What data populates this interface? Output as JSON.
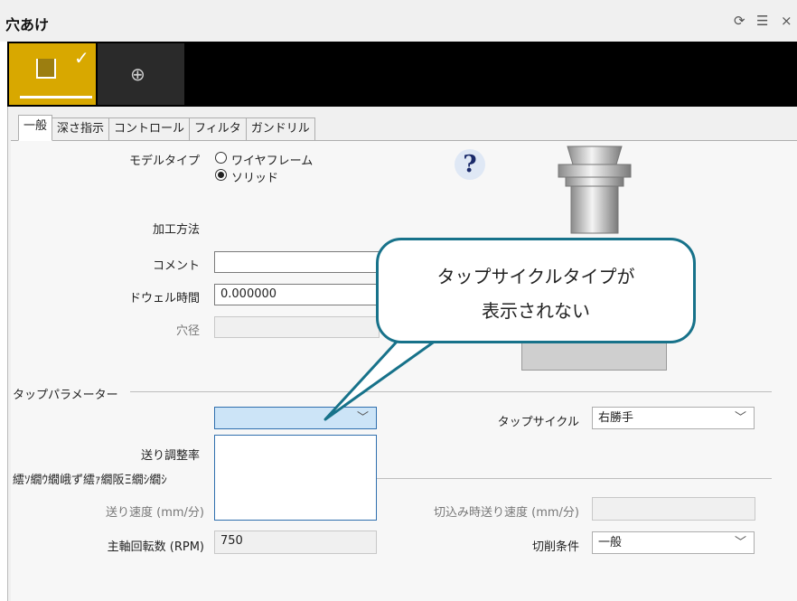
{
  "window": {
    "title": "穴あけ",
    "icons": {
      "pin": "pin-icon",
      "menu": "menu-icon",
      "close": "close-icon"
    }
  },
  "toolbar": {
    "tool_drill": {
      "icon": "drill-tool-icon",
      "checked_icon": "check-icon"
    },
    "tool_position": {
      "icon": "crosshair-icon"
    }
  },
  "tabs": [
    "一般",
    "深さ指示",
    "コントロール",
    "フィルタ",
    "ガンドリル"
  ],
  "general": {
    "model_type_label": "モデルタイプ",
    "model_type_options": [
      "ワイヤフレーム",
      "ソリッド"
    ],
    "model_type_selected": "ソリッド",
    "machining_method_label": "加工方法",
    "comment_label": "コメント",
    "comment_value": "",
    "dwell_label": "ドウェル時間",
    "dwell_value": "0.000000",
    "hole_diameter_label": "穴径",
    "hole_diameter_value": ""
  },
  "tap_params": {
    "section_title": "タップパラメーター",
    "combo_value": "",
    "tap_cycle_label": "タップサイクル",
    "tap_cycle_value": "右勝手",
    "feed_adjust_label": "送り調整率"
  },
  "section2": {
    "title": "繧ｿ繝ｳ繝峨ず繧ｧ繝阪Ξ繝ｼ繝ｼ"
  },
  "feeds": {
    "feed_rate_label": "送り速度 (mm/分)",
    "plunge_feed_label": "切込み時送り速度 (mm/分)",
    "plunge_feed_value": "",
    "spindle_label": "主軸回転数 (RPM)",
    "spindle_value": "750",
    "cut_condition_label": "切削条件",
    "cut_condition_value": "一般"
  },
  "callout": {
    "line1": "タップサイクルタイプが",
    "line2": "表示されない"
  },
  "colors": {
    "accent": "#d8a800",
    "callout_border": "#17728a",
    "focus": "#2f6fae"
  }
}
